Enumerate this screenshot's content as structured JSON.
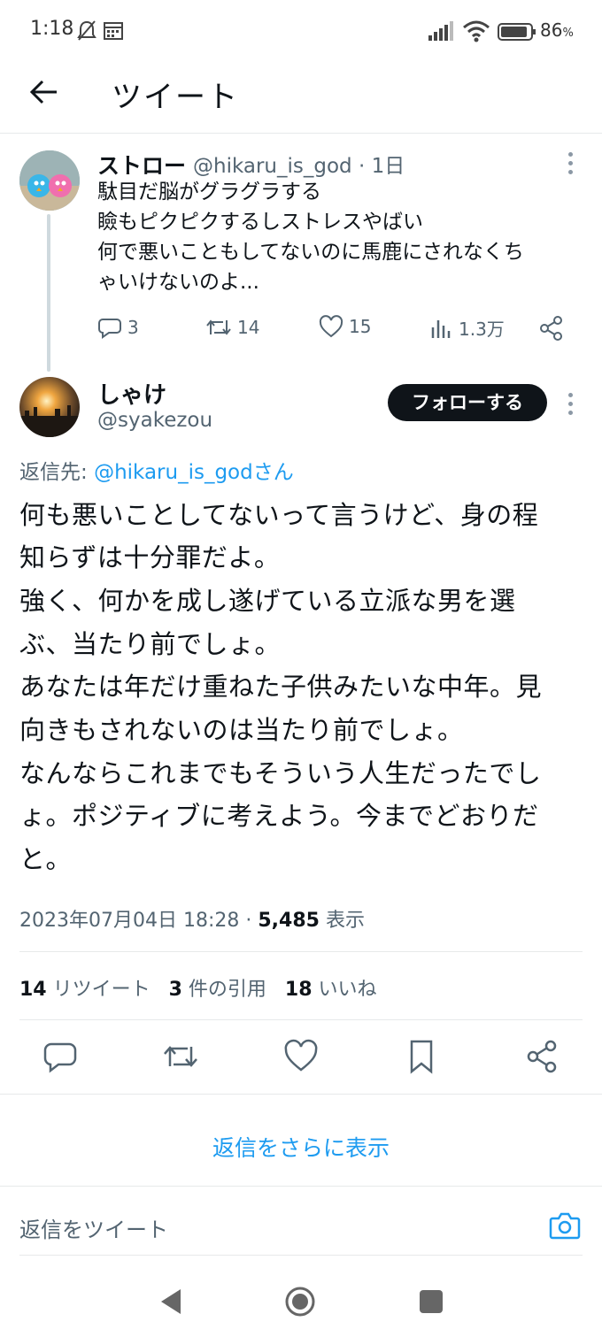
{
  "status_bar": {
    "time": "1:18",
    "battery": "86",
    "battery_unit": "%"
  },
  "header": {
    "title": "ツイート"
  },
  "parent_tweet": {
    "name": "ストロー",
    "handle": "@hikaru_is_god",
    "time_sep": " · ",
    "time": "1日",
    "lines": [
      "駄目だ脳がグラグラする",
      "瞼もピクピクするしストレスやばい",
      "何で悪いこともしてないのに馬鹿にされなくち",
      "ゃいけないのよ..."
    ],
    "replies": "3",
    "retweets": "14",
    "likes": "15",
    "views": "1.3万"
  },
  "main_tweet": {
    "name": "しゃけ",
    "handle": "@syakezou",
    "follow_label": "フォローする",
    "reply_to_prefix": "返信先: ",
    "reply_to_handle": "@hikaru_is_godさん",
    "body_lines": [
      "何も悪いことしてないって言うけど、身の程",
      "知らずは十分罪だよ。",
      "強く、何かを成し遂げている立派な男を選",
      "ぶ、当たり前でしょ。",
      "あなたは年だけ重ねた子供みたいな中年。見",
      "向きもされないのは当たり前でしょ。",
      "なんならこれまでもそういう人生だったでし",
      "ょ。ポジティブに考えよう。今までどおりだ",
      "と。"
    ],
    "date": "2023年07月04日 18:28",
    "meta_sep": " · ",
    "view_count": "5,485",
    "view_label": " 表示",
    "retweet_count": "14",
    "retweet_label": " リツイート",
    "quote_count": "3",
    "quote_label": " 件の引用",
    "like_count": "18",
    "like_label": " いいね"
  },
  "show_more_replies": "返信をさらに表示",
  "reply_placeholder": "返信をツイート",
  "colors": {
    "accent": "#1d9bf0",
    "text": "#0f1419",
    "secondary": "#536471",
    "divider": "#e7e9ea"
  }
}
